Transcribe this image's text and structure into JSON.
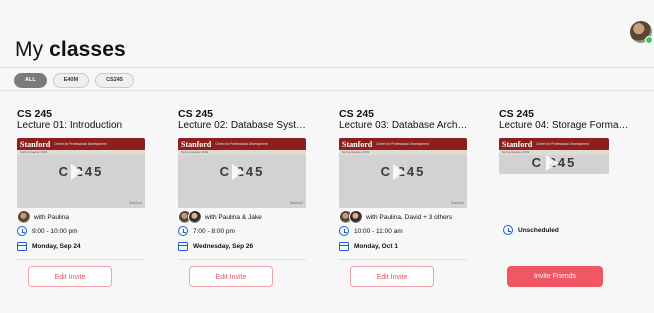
{
  "header": {
    "title_light": "My",
    "title_bold": "classes"
  },
  "filters": [
    {
      "label": "ALL",
      "active": true
    },
    {
      "label": "E40M",
      "active": false
    },
    {
      "label": "CS245",
      "active": false
    }
  ],
  "thumbnail": {
    "logo": "Stanford",
    "sublogo": "Center for Professional Development",
    "strip": "Spring Quarter 2019",
    "course_text": "C 245",
    "corner": "Stanford"
  },
  "cards": [
    {
      "course": "CS 245",
      "lecture": "Lecture 01: Introduction",
      "with": "with Paulina",
      "time": "9:00 - 10:00 pm",
      "date": "Monday, Sep 24",
      "button": "Edit Invite"
    },
    {
      "course": "CS 245",
      "lecture": "Lecture 02: Database System...",
      "with": "with Paulina & Jake",
      "time": "7:00 - 8:00 pm",
      "date": "Wednesday, Sep 26",
      "button": "Edit Invite"
    },
    {
      "course": "CS 245",
      "lecture": "Lecture 03: Database Archite...",
      "with": "with Paulina, David + 3 others",
      "time": "10:00 - 11:00 am",
      "date": "Monday, Oct 1",
      "button": "Edit Invite"
    },
    {
      "course": "CS 245",
      "lecture": "Lecture 04: Storage Formats ...",
      "schedule": "Unscheduled",
      "button": "Invite Friends"
    }
  ],
  "colors": {
    "accent": "#f05663",
    "icon_blue": "#1b5fd6",
    "stanford_red": "#8d1f1f"
  }
}
